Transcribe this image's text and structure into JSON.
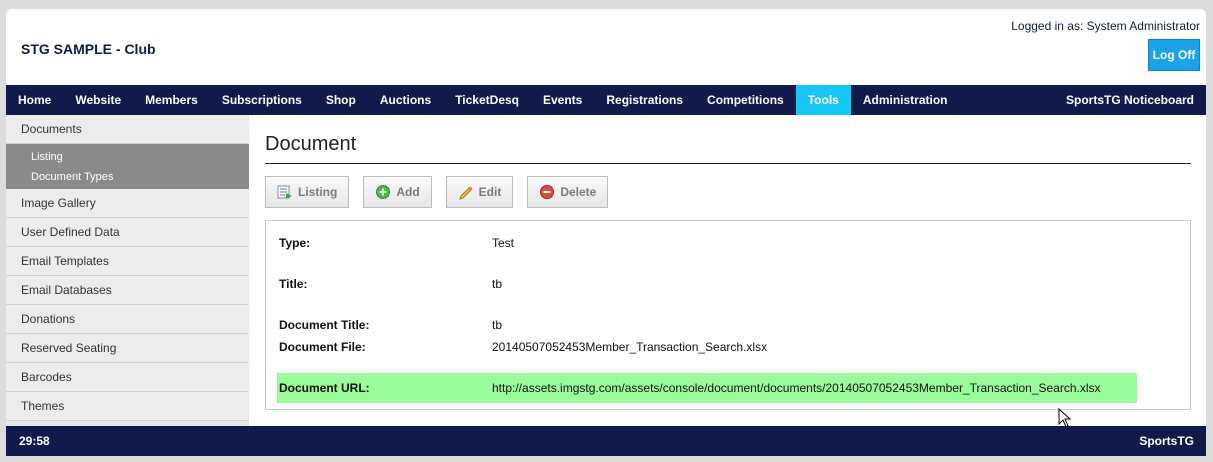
{
  "header": {
    "app_title": "STG SAMPLE - Club",
    "logged_in_text": "Logged in as: System Administrator",
    "log_off_label": "Log Off"
  },
  "nav": {
    "items": [
      "Home",
      "Website",
      "Members",
      "Subscriptions",
      "Shop",
      "Auctions",
      "TicketDesq",
      "Events",
      "Registrations",
      "Competitions",
      "Tools",
      "Administration"
    ],
    "active": "Tools",
    "right_label": "SportsTG Noticeboard",
    "accent_color": "#17c6f2",
    "bar_color": "#111a4a"
  },
  "sidebar": {
    "items": [
      {
        "label": "Documents"
      },
      {
        "label": "Image Gallery"
      },
      {
        "label": "User Defined Data"
      },
      {
        "label": "Email Templates"
      },
      {
        "label": "Email Databases"
      },
      {
        "label": "Donations"
      },
      {
        "label": "Reserved Seating"
      },
      {
        "label": "Barcodes"
      },
      {
        "label": "Themes"
      }
    ],
    "sub_items": [
      "Listing",
      "Document Types"
    ]
  },
  "main": {
    "title": "Document",
    "toolbar": {
      "listing": "Listing",
      "add": "Add",
      "edit": "Edit",
      "delete": "Delete"
    },
    "fields": [
      {
        "label": "Type:",
        "value": "Test"
      },
      {
        "label": "Title:",
        "value": "tb"
      },
      {
        "label": "Document Title:",
        "value": "tb"
      },
      {
        "label": "Document File:",
        "value": "20140507052453Member_Transaction_Search.xlsx"
      },
      {
        "label": "Document URL:",
        "value": "http://assets.imgstg.com/assets/console/document/documents/20140507052453Member_Transaction_Search.xlsx"
      }
    ],
    "highlight_color": "#9afb9a"
  },
  "footer": {
    "timer": "29:58",
    "brand": "SportsTG"
  }
}
